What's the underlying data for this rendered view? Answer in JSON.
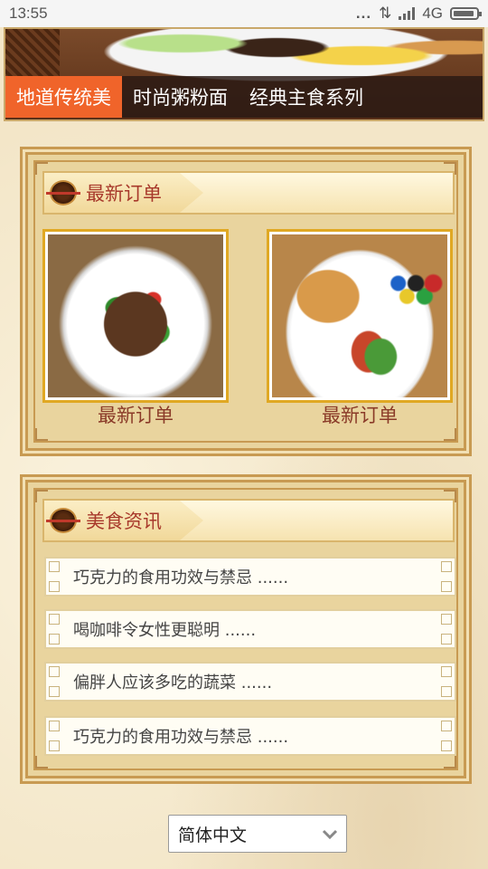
{
  "status_bar": {
    "time": "13:55",
    "network": "4G",
    "dots": "..."
  },
  "nav": {
    "tabs": [
      {
        "label": "地道传统美",
        "active": true
      },
      {
        "label": "时尚粥粉面",
        "active": false
      },
      {
        "label": "经典主食系列",
        "active": false
      }
    ]
  },
  "orders_panel": {
    "title": "最新订单",
    "cards": [
      {
        "caption": "最新订单"
      },
      {
        "caption": "最新订单"
      }
    ]
  },
  "news_panel": {
    "title": "美食资讯",
    "items": [
      {
        "text": "巧克力的食用功效与禁忌 ......"
      },
      {
        "text": "喝咖啡令女性更聪明 ......"
      },
      {
        "text": "偏胖人应该多吃的蔬菜   ......"
      },
      {
        "text": "巧克力的食用功效与禁忌 ......"
      }
    ]
  },
  "language_select": {
    "value": "简体中文"
  },
  "colors": {
    "accent_tab": "#f0642a",
    "title_red": "#a8392b",
    "card_border": "#e0a823"
  }
}
